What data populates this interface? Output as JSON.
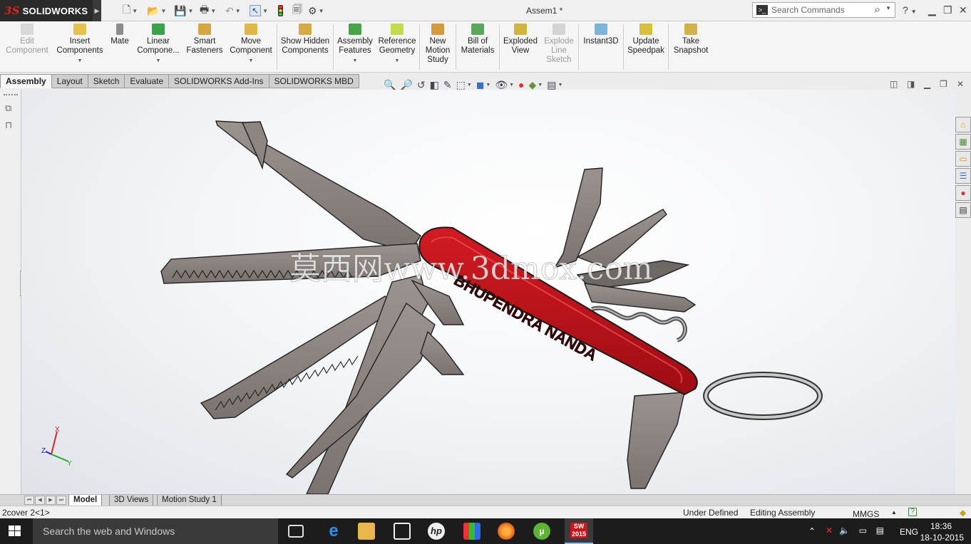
{
  "titlebar": {
    "app_name": "SOLIDWORKS",
    "doc_title": "Assem1 *",
    "search_placeholder": "Search Commands",
    "help": "?"
  },
  "ribbon": {
    "buttons": [
      {
        "label": "Edit Component",
        "enabled": false
      },
      {
        "label": "Insert Components",
        "enabled": true
      },
      {
        "label": "Mate",
        "enabled": true
      },
      {
        "label": "Linear Compone...",
        "enabled": true
      },
      {
        "label": "Smart Fasteners",
        "enabled": true
      },
      {
        "label": "Move Component",
        "enabled": true
      },
      {
        "label": "Show Hidden Components",
        "enabled": true
      },
      {
        "label": "Assembly Features",
        "enabled": true
      },
      {
        "label": "Reference Geometry",
        "enabled": true
      },
      {
        "label": "New Motion Study",
        "enabled": true
      },
      {
        "label": "Bill of Materials",
        "enabled": true
      },
      {
        "label": "Exploded View",
        "enabled": true
      },
      {
        "label": "Explode Line Sketch",
        "enabled": false
      },
      {
        "label": "Instant3D",
        "enabled": true
      },
      {
        "label": "Update Speedpak",
        "enabled": true
      },
      {
        "label": "Take Snapshot",
        "enabled": true
      }
    ]
  },
  "command_tabs": [
    "Assembly",
    "Layout",
    "Sketch",
    "Evaluate",
    "SOLIDWORKS Add-Ins",
    "SOLIDWORKS MBD"
  ],
  "active_command_tab": "Assembly",
  "viewport": {
    "engraving": "BHUPENDRA NANDA",
    "watermark": "莫西网www.3dmox.com",
    "triad_x": "X",
    "triad_y": "Y",
    "triad_z": "Z"
  },
  "model_tabs": [
    "Model",
    "3D Views",
    "Motion Study 1"
  ],
  "active_model_tab": "Model",
  "statusbar": {
    "selection": "2cover 2<1>",
    "state": "Under Defined",
    "mode": "Editing Assembly",
    "units": "MMGS"
  },
  "taskbar": {
    "search_placeholder": "Search the web and Windows",
    "language": "ENG",
    "time": "18:36",
    "date": "18-10-2015",
    "sw_badge": "2015"
  },
  "colors": {
    "accent_red": "#b8121a",
    "taskbar": "#1c1c1c",
    "knife_body": "#c0171f",
    "blade": "#8a837f"
  }
}
